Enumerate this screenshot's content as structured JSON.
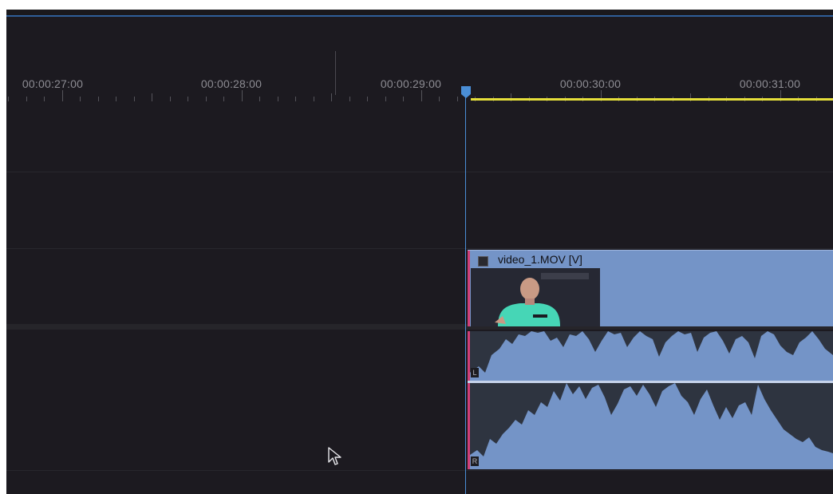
{
  "ruler": {
    "timecodes": [
      "00:00:27:00",
      "00:00:28:00",
      "00:00:29:00",
      "00:00:30:00",
      "00:00:31:00"
    ]
  },
  "video_clip": {
    "title": "video_1.MOV [V]",
    "color": "#7494c7"
  },
  "audio_clip": {
    "channel_left": "L",
    "channel_right": "R",
    "color": "#7494c7"
  },
  "colors": {
    "background": "#1c1a20",
    "playhead": "#4a8ed6",
    "work_area": "#e5df3a",
    "clip_edge": "#d23e77"
  },
  "icons": {
    "playhead": "playhead-marker-icon",
    "cursor": "mouse-pointer-icon",
    "clip_fx": "fx-badge-icon"
  }
}
